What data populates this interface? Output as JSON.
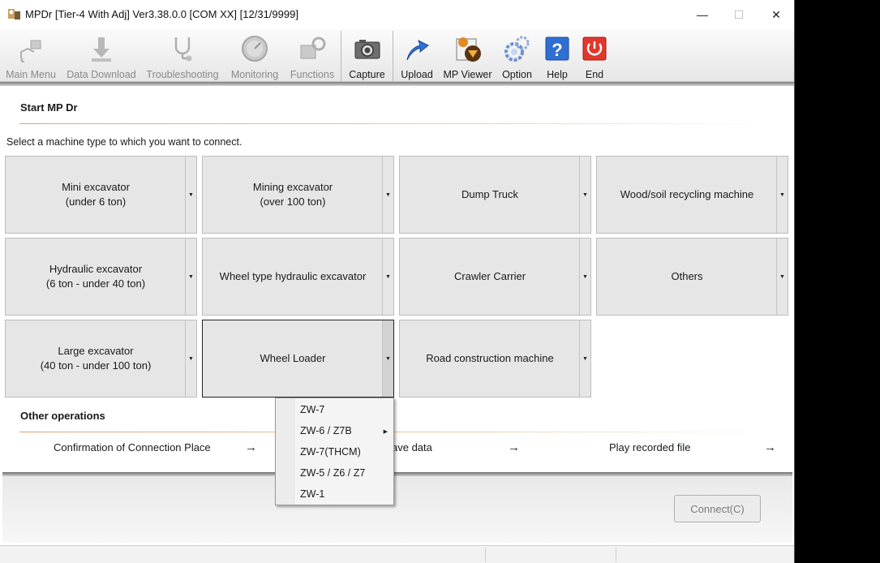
{
  "window": {
    "title": "MPDr [Tier-4 With Adj] Ver3.38.0.0 [COM XX] [12/31/9999]",
    "controls": {
      "minimize": "—",
      "maximize": "☐",
      "close": "✕"
    }
  },
  "toolbar": {
    "items": [
      {
        "label": "Main Menu",
        "icon": "main-menu-icon",
        "enabled": false
      },
      {
        "label": "Data Download",
        "icon": "download-icon",
        "enabled": false
      },
      {
        "label": "Troubleshooting",
        "icon": "stethoscope-icon",
        "enabled": false
      },
      {
        "label": "Monitoring",
        "icon": "gauge-icon",
        "enabled": false
      },
      {
        "label": "Functions",
        "icon": "functions-icon",
        "enabled": false
      },
      {
        "label": "Capture",
        "icon": "camera-icon",
        "enabled": true
      },
      {
        "label": "Upload",
        "icon": "upload-icon",
        "enabled": true
      },
      {
        "label": "MP Viewer",
        "icon": "viewer-icon",
        "enabled": true
      },
      {
        "label": "Option",
        "icon": "gears-icon",
        "enabled": true
      },
      {
        "label": "Help",
        "icon": "help-icon",
        "enabled": true
      },
      {
        "label": "End",
        "icon": "power-icon",
        "enabled": true
      }
    ]
  },
  "start": {
    "title": "Start MP Dr",
    "instruction": "Select a machine type to which you want to connect."
  },
  "machines": [
    {
      "line1": "Mini excavator",
      "line2": "(under 6 ton)"
    },
    {
      "line1": "Mining excavator",
      "line2": "(over 100 ton)"
    },
    {
      "line1": "Dump Truck",
      "line2": ""
    },
    {
      "line1": "Wood/soil recycling machine",
      "line2": ""
    },
    {
      "line1": "Hydraulic excavator",
      "line2": "(6 ton - under 40 ton)"
    },
    {
      "line1": "Wheel type hydraulic excavator",
      "line2": ""
    },
    {
      "line1": "Crawler Carrier",
      "line2": ""
    },
    {
      "line1": "Others",
      "line2": ""
    },
    {
      "line1": "Large excavator",
      "line2": "(40 ton - under 100 ton)"
    },
    {
      "line1": "Wheel Loader",
      "line2": ""
    },
    {
      "line1": "Road construction machine",
      "line2": ""
    }
  ],
  "dropdown_glyph": "▼",
  "other_ops": {
    "title": "Other operations",
    "links": [
      {
        "label": "Confirmation of Connection Place",
        "arrow": "→"
      },
      {
        "label": "ave data",
        "arrow": "→"
      },
      {
        "label": "Play recorded file",
        "arrow": "→"
      }
    ]
  },
  "popup": {
    "items": [
      {
        "label": "ZW-7",
        "has_submenu": false
      },
      {
        "label": "ZW-6 / Z7B",
        "has_submenu": true
      },
      {
        "label": "ZW-7(THCM)",
        "has_submenu": false
      },
      {
        "label": "ZW-5 / Z6 / Z7",
        "has_submenu": false
      },
      {
        "label": "ZW-1",
        "has_submenu": false
      }
    ],
    "submenu_glyph": "▶"
  },
  "footer": {
    "connect_label": "Connect(C)"
  }
}
